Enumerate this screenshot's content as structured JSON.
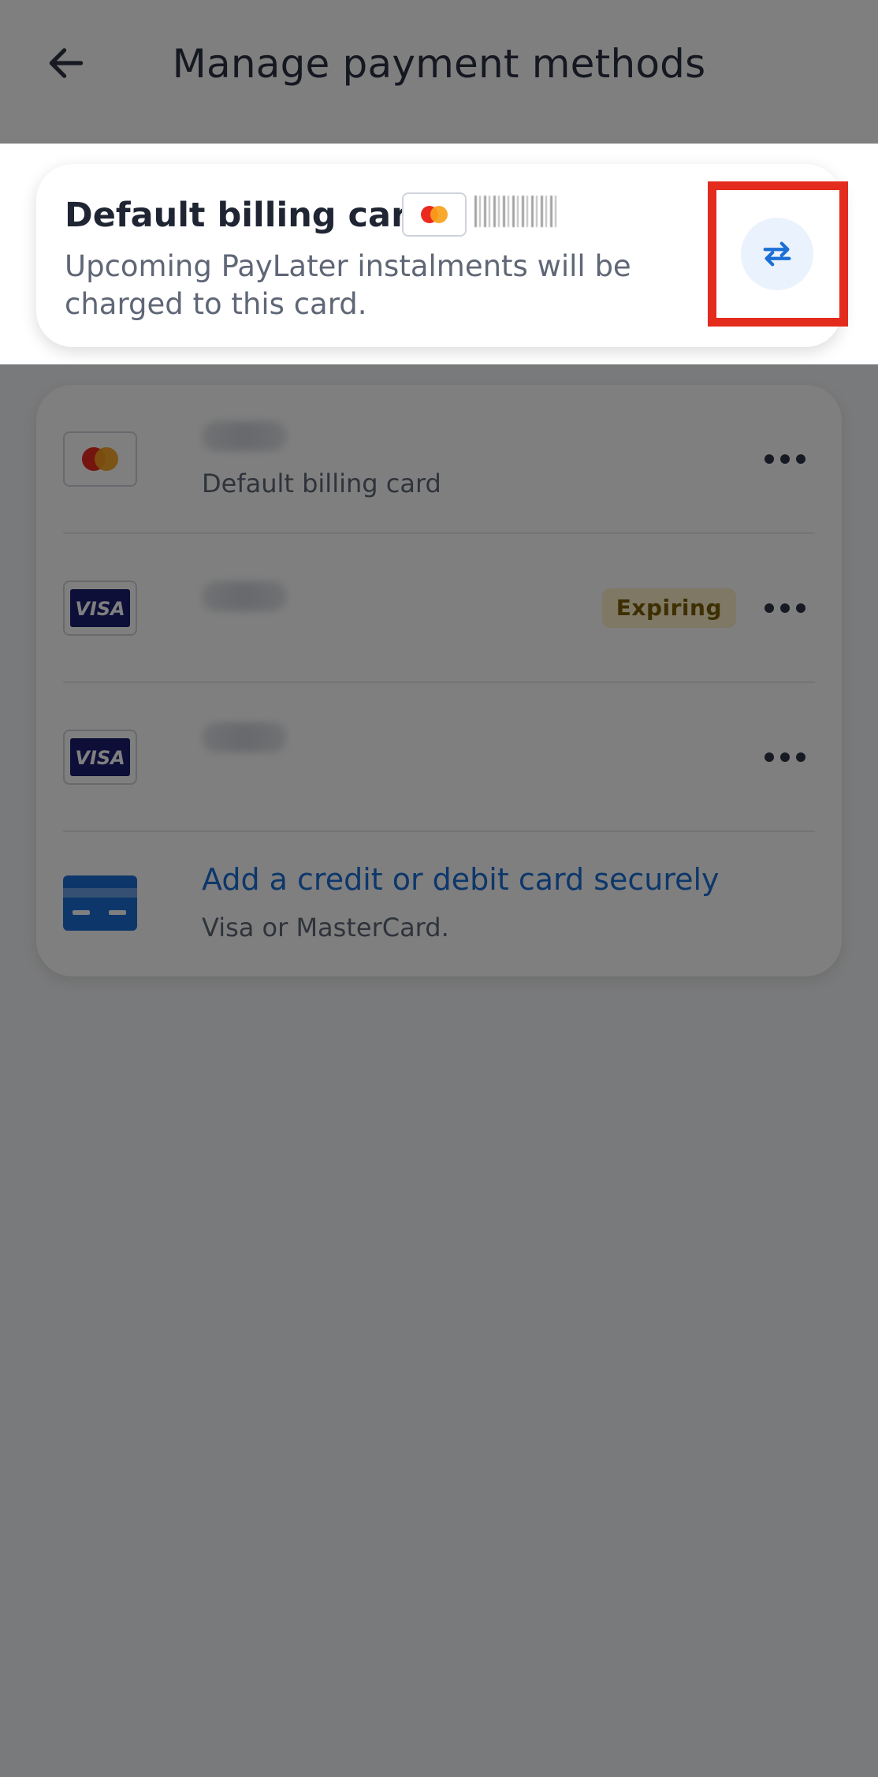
{
  "header": {
    "title": "Manage payment methods",
    "back_icon": "arrow-left-icon"
  },
  "billing": {
    "title": "Default billing card:",
    "description": "Upcoming PayLater instalments will be charged to this card.",
    "card_brand": "mastercard",
    "swap_icon": "swap-arrows-icon"
  },
  "cards": [
    {
      "brand": "mastercard",
      "subtitle": "Default billing card",
      "badge": ""
    },
    {
      "brand": "visa",
      "subtitle": "",
      "badge": "Expiring"
    },
    {
      "brand": "visa",
      "subtitle": "",
      "badge": ""
    }
  ],
  "add_card": {
    "title": "Add a credit or debit card securely",
    "subtitle": "Visa or MasterCard."
  },
  "colors": {
    "accent": "#1b6fd6",
    "highlight": "#e32b1e",
    "badge_bg": "#fdf1c8",
    "badge_text": "#7d5f06"
  }
}
